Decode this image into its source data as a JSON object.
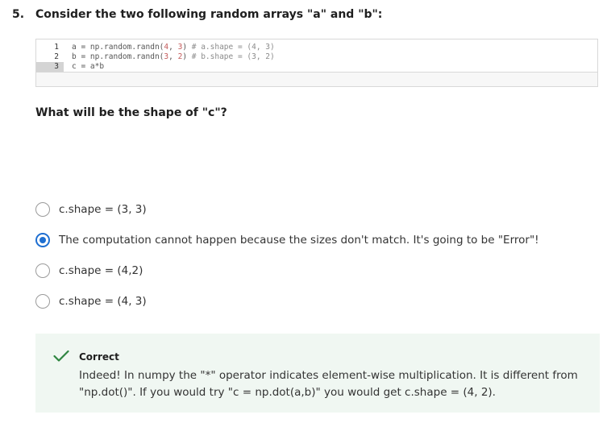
{
  "question": {
    "number": "5.",
    "prompt": "Consider the two following random arrays \"a\" and \"b\":",
    "sub_prompt": "What will be the shape of \"c\"?"
  },
  "code": {
    "lines": [
      {
        "number": "1",
        "parts": [
          {
            "text": "a = np.random.randn(",
            "kind": "plain"
          },
          {
            "text": "4",
            "kind": "num"
          },
          {
            "text": ", ",
            "kind": "plain"
          },
          {
            "text": "3",
            "kind": "num"
          },
          {
            "text": ") ",
            "kind": "plain"
          },
          {
            "text": "# a.shape = (4, 3)",
            "kind": "cmt"
          }
        ]
      },
      {
        "number": "2",
        "parts": [
          {
            "text": "b = np.random.randn(",
            "kind": "plain"
          },
          {
            "text": "3",
            "kind": "num"
          },
          {
            "text": ", ",
            "kind": "plain"
          },
          {
            "text": "2",
            "kind": "num"
          },
          {
            "text": ") ",
            "kind": "plain"
          },
          {
            "text": "# b.shape = (3, 2)",
            "kind": "cmt"
          }
        ]
      },
      {
        "number": "3",
        "parts": [
          {
            "text": "c = a*b",
            "kind": "plain"
          }
        ]
      }
    ]
  },
  "options": [
    {
      "label": "c.shape = (3, 3)",
      "selected": false
    },
    {
      "label": "The computation cannot happen because the sizes don't match. It's going to be \"Error\"!",
      "selected": true
    },
    {
      "label": "c.shape = (4,2)",
      "selected": false
    },
    {
      "label": "c.shape = (4, 3)",
      "selected": false
    }
  ],
  "feedback": {
    "status": "Correct",
    "icon": "check-icon",
    "text": "Indeed! In numpy the \"*\" operator indicates element-wise multiplication. It is different from \"np.dot()\". If you would try \"c = np.dot(a,b)\" you would get c.shape = (4, 2).",
    "color": "#2e8540",
    "background": "#f0f7f2"
  }
}
